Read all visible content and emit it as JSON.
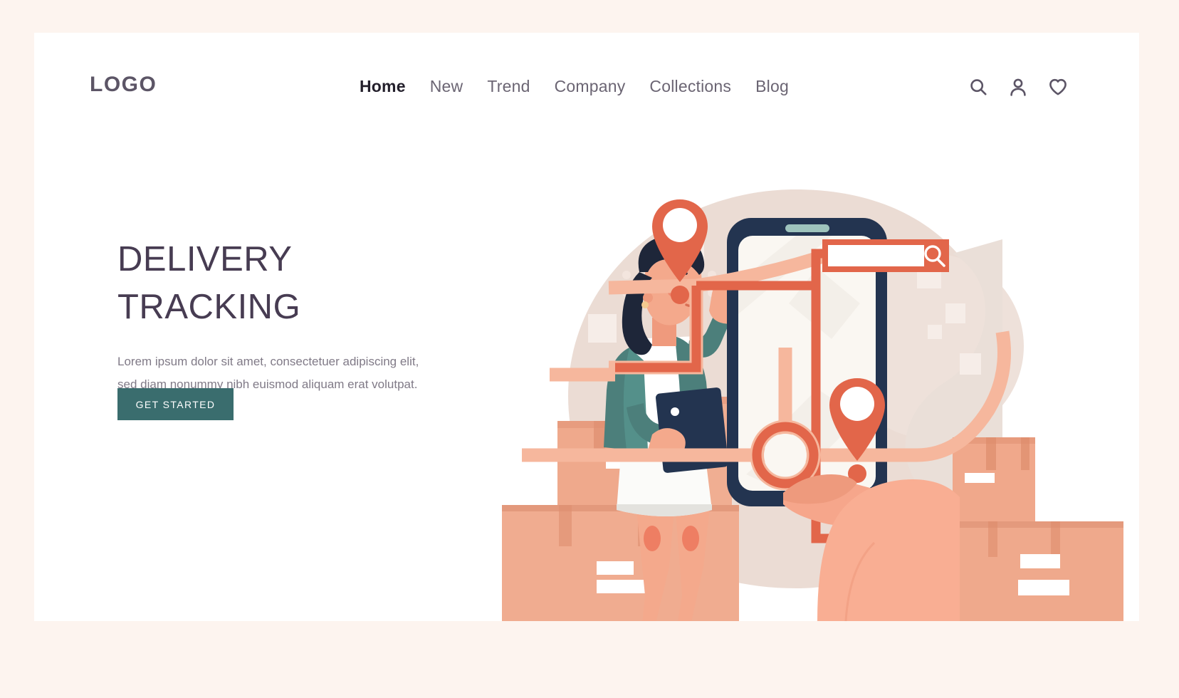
{
  "header": {
    "logo": "LOGO",
    "nav": [
      {
        "label": "Home",
        "active": true
      },
      {
        "label": "New",
        "active": false
      },
      {
        "label": "Trend",
        "active": false
      },
      {
        "label": "Company",
        "active": false
      },
      {
        "label": "Collections",
        "active": false
      },
      {
        "label": "Blog",
        "active": false
      }
    ],
    "icons": [
      "search-icon",
      "user-icon",
      "heart-icon"
    ]
  },
  "hero": {
    "title_line1": "DELIVERY",
    "title_line2": "TRACKING",
    "paragraph": "Lorem ipsum dolor sit amet, consectetuer adipiscing elit, sed diam nonummy nibh euismod aliquam erat volutpat.",
    "cta_label": "GET STARTED"
  },
  "illustration": {
    "alt": "Woman with tablet beside stacked parcels, hand holding a smartphone showing a delivery map with route, roundabout, two location pins and an empty search field",
    "search_field_value": "",
    "pins": 2
  },
  "colors": {
    "page_background": "#FDF4EF",
    "card_background": "#FFFFFF",
    "heading": "#473C52",
    "body_text": "#807A87",
    "nav_text": "#6B6573",
    "nav_active": "#231F2B",
    "cta_background": "#3A6D6E",
    "cta_text": "#FFFFFF",
    "accent_coral": "#E2664A",
    "accent_salmon": "#F3A58A",
    "accent_peach": "#F6A68B",
    "blob_beige": "#EBDCD4",
    "phone_navy": "#233450",
    "jacket_teal": "#4C7F7B",
    "box_tan": "#EFA98C"
  }
}
